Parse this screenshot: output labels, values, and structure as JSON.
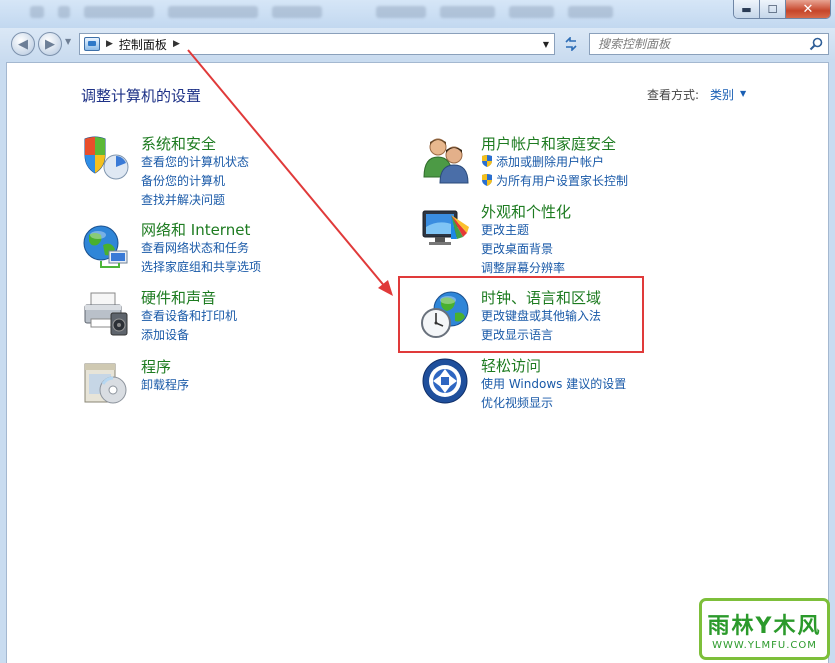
{
  "address": {
    "breadcrumb": "控制面板",
    "search_placeholder": "搜索控制面板"
  },
  "header": {
    "title": "调整计算机的设置",
    "view_label": "查看方式:",
    "view_value": "类别"
  },
  "categories": [
    {
      "title": "系统和安全",
      "links": [
        "查看您的计算机状态",
        "备份您的计算机",
        "查找并解决问题"
      ],
      "icon": "shield-computer-icon"
    },
    {
      "title": "网络和 Internet",
      "links": [
        "查看网络状态和任务",
        "选择家庭组和共享选项"
      ],
      "icon": "network-globe-icon"
    },
    {
      "title": "硬件和声音",
      "links": [
        "查看设备和打印机",
        "添加设备"
      ],
      "icon": "printer-icon"
    },
    {
      "title": "程序",
      "links": [
        "卸载程序"
      ],
      "icon": "programs-icon"
    },
    {
      "title": "用户帐户和家庭安全",
      "links": [
        "添加或删除用户帐户",
        "为所有用户设置家长控制"
      ],
      "icon": "users-icon"
    },
    {
      "title": "外观和个性化",
      "links": [
        "更改主题",
        "更改桌面背景",
        "调整屏幕分辨率"
      ],
      "icon": "monitor-colors-icon"
    },
    {
      "title": "时钟、语言和区域",
      "links": [
        "更改键盘或其他输入法",
        "更改显示语言"
      ],
      "icon": "globe-clock-icon"
    },
    {
      "title": "轻松访问",
      "links": [
        "使用 Windows 建议的设置",
        "优化视频显示"
      ],
      "icon": "ease-of-access-icon"
    }
  ],
  "annotation": {
    "color": "#e03a3a"
  },
  "watermark": {
    "main": "雨林Y木风",
    "sub": "WWW.YLMFU.COM"
  },
  "colors": {
    "title_green": "#1d7b20",
    "link_blue": "#1a5aa8",
    "page_title": "#1e3287"
  }
}
